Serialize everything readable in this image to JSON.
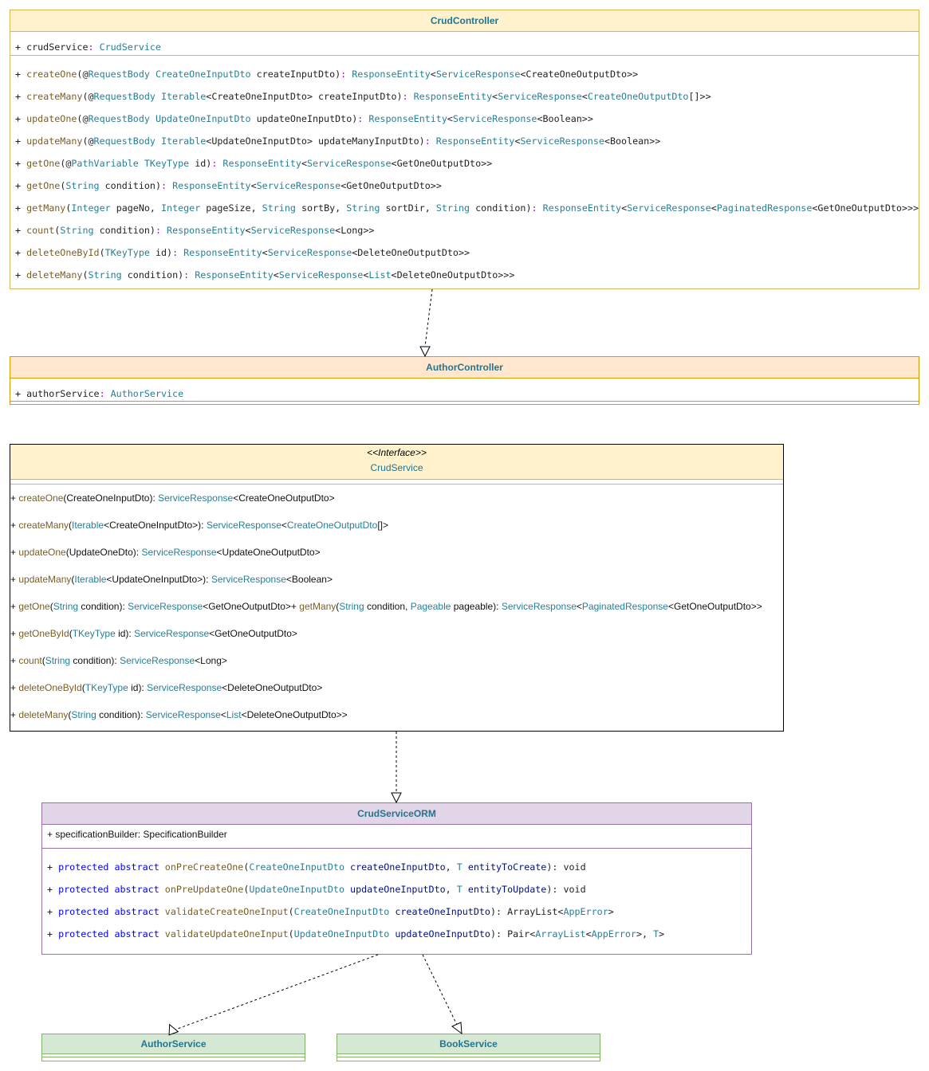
{
  "classes": {
    "crud_controller": {
      "title": "CrudController",
      "attributes": [
        [
          [
            "p",
            "+ crudService"
          ],
          [
            "c",
            ": "
          ],
          [
            "t",
            "CrudService"
          ]
        ]
      ],
      "methods": [
        [
          [
            "p",
            "+ "
          ],
          [
            "m",
            "createOne"
          ],
          [
            "p",
            "(@"
          ],
          [
            "t",
            "RequestBody"
          ],
          [
            "p",
            " "
          ],
          [
            "t",
            "CreateOneInputDto"
          ],
          [
            "p",
            " createInputDto)"
          ],
          [
            "c",
            ": "
          ],
          [
            "t",
            "ResponseEntity"
          ],
          [
            "p",
            "<"
          ],
          [
            "t",
            "ServiceResponse"
          ],
          [
            "p",
            "<CreateOneOutputDto>>"
          ]
        ],
        [
          [
            "p",
            "+ "
          ],
          [
            "m",
            "createMany"
          ],
          [
            "p",
            "(@"
          ],
          [
            "t",
            "RequestBody"
          ],
          [
            "p",
            " "
          ],
          [
            "t",
            "Iterable"
          ],
          [
            "p",
            "<CreateOneInputDto> createInputDto)"
          ],
          [
            "c",
            ": "
          ],
          [
            "t",
            "ResponseEntity"
          ],
          [
            "p",
            "<"
          ],
          [
            "t",
            "ServiceResponse"
          ],
          [
            "p",
            "<"
          ],
          [
            "t",
            "CreateOneOutputDto"
          ],
          [
            "p",
            "[]>>"
          ]
        ],
        [
          [
            "p",
            "+ "
          ],
          [
            "m",
            "updateOne"
          ],
          [
            "p",
            "(@"
          ],
          [
            "t",
            "RequestBody"
          ],
          [
            "p",
            " "
          ],
          [
            "t",
            "UpdateOneInputDto"
          ],
          [
            "p",
            " updateOneInputDto)"
          ],
          [
            "c",
            ": "
          ],
          [
            "t",
            "ResponseEntity"
          ],
          [
            "p",
            "<"
          ],
          [
            "t",
            "ServiceResponse"
          ],
          [
            "p",
            "<Boolean>>"
          ]
        ],
        [
          [
            "p",
            "+ "
          ],
          [
            "m",
            "updateMany"
          ],
          [
            "p",
            "(@"
          ],
          [
            "t",
            "RequestBody"
          ],
          [
            "p",
            " "
          ],
          [
            "t",
            "Iterable"
          ],
          [
            "p",
            "<UpdateOneInputDto> updateManyInputDto)"
          ],
          [
            "c",
            ": "
          ],
          [
            "t",
            "ResponseEntity"
          ],
          [
            "p",
            "<"
          ],
          [
            "t",
            "ServiceResponse"
          ],
          [
            "p",
            "<Boolean>>"
          ]
        ],
        [
          [
            "p",
            "+ "
          ],
          [
            "m",
            "getOne"
          ],
          [
            "p",
            "(@"
          ],
          [
            "t",
            "PathVariable"
          ],
          [
            "p",
            " "
          ],
          [
            "t",
            "TKeyType"
          ],
          [
            "p",
            " id)"
          ],
          [
            "c",
            ": "
          ],
          [
            "t",
            "ResponseEntity"
          ],
          [
            "p",
            "<"
          ],
          [
            "t",
            "ServiceResponse"
          ],
          [
            "p",
            "<GetOneOutputDto>>"
          ]
        ],
        [
          [
            "p",
            "+ "
          ],
          [
            "m",
            "getOne"
          ],
          [
            "p",
            "("
          ],
          [
            "t",
            "String"
          ],
          [
            "p",
            " condition)"
          ],
          [
            "c",
            ": "
          ],
          [
            "t",
            "ResponseEntity"
          ],
          [
            "p",
            "<"
          ],
          [
            "t",
            "ServiceResponse"
          ],
          [
            "p",
            "<GetOneOutputDto>>"
          ]
        ],
        [
          [
            "p",
            "+ "
          ],
          [
            "m",
            "getMany"
          ],
          [
            "p",
            "("
          ],
          [
            "t",
            "Integer"
          ],
          [
            "p",
            " pageNo, "
          ],
          [
            "t",
            "Integer"
          ],
          [
            "p",
            " pageSize, "
          ],
          [
            "t",
            "String"
          ],
          [
            "p",
            " sortBy, "
          ],
          [
            "t",
            "String"
          ],
          [
            "p",
            " sortDir, "
          ],
          [
            "t",
            "String"
          ],
          [
            "p",
            " condition)"
          ],
          [
            "c",
            ": "
          ],
          [
            "t",
            "ResponseEntity"
          ],
          [
            "p",
            "<"
          ],
          [
            "t",
            "ServiceResponse"
          ],
          [
            "p",
            "<"
          ],
          [
            "t",
            "PaginatedResponse"
          ],
          [
            "p",
            "<GetOneOutputDto>>>"
          ]
        ],
        [
          [
            "p",
            "+ "
          ],
          [
            "m",
            "count"
          ],
          [
            "p",
            "("
          ],
          [
            "t",
            "String"
          ],
          [
            "p",
            " condition)"
          ],
          [
            "c",
            ": "
          ],
          [
            "t",
            "ResponseEntity"
          ],
          [
            "p",
            "<"
          ],
          [
            "t",
            "ServiceResponse"
          ],
          [
            "p",
            "<Long>>"
          ]
        ],
        [
          [
            "p",
            "+ "
          ],
          [
            "m",
            "deleteOneById"
          ],
          [
            "p",
            "("
          ],
          [
            "t",
            "TKeyType"
          ],
          [
            "p",
            " id)"
          ],
          [
            "c",
            ": "
          ],
          [
            "t",
            "ResponseEntity"
          ],
          [
            "p",
            "<"
          ],
          [
            "t",
            "ServiceResponse"
          ],
          [
            "p",
            "<DeleteOneOutputDto>>"
          ]
        ],
        [
          [
            "p",
            "+ "
          ],
          [
            "m",
            "deleteMany"
          ],
          [
            "p",
            "("
          ],
          [
            "t",
            "String"
          ],
          [
            "p",
            " condition)"
          ],
          [
            "c",
            ": "
          ],
          [
            "t",
            "ResponseEntity"
          ],
          [
            "p",
            "<"
          ],
          [
            "t",
            "ServiceResponse"
          ],
          [
            "p",
            "<"
          ],
          [
            "t",
            "List"
          ],
          [
            "p",
            "<DeleteOneOutputDto>>>"
          ]
        ]
      ]
    },
    "author_controller": {
      "title": "AuthorController",
      "attributes": [
        [
          [
            "p",
            "+ authorService"
          ],
          [
            "c",
            ": "
          ],
          [
            "t",
            "AuthorService"
          ]
        ]
      ]
    },
    "crud_service": {
      "stereotype": "<<Interface>>",
      "title": "CrudService",
      "methods": [
        [
          [
            "p",
            "+ "
          ],
          [
            "m",
            "createOne"
          ],
          [
            "p",
            "(CreateOneInputDto): "
          ],
          [
            "t",
            "ServiceResponse"
          ],
          [
            "p",
            "<CreateOneOutputDto>"
          ]
        ],
        [
          [
            "p",
            "+ "
          ],
          [
            "m",
            "createMany"
          ],
          [
            "p",
            "("
          ],
          [
            "t",
            "Iterable"
          ],
          [
            "p",
            "<CreateOneInputDto>): "
          ],
          [
            "t",
            "ServiceResponse"
          ],
          [
            "p",
            "<"
          ],
          [
            "t",
            "CreateOneOutputDto"
          ],
          [
            "p",
            "[]>"
          ]
        ],
        [
          [
            "p",
            "+ "
          ],
          [
            "m",
            "updateOne"
          ],
          [
            "p",
            "(UpdateOneDto): "
          ],
          [
            "t",
            "ServiceResponse"
          ],
          [
            "p",
            "<UpdateOneOutputDto>"
          ]
        ],
        [
          [
            "p",
            "+ "
          ],
          [
            "m",
            "updateMany"
          ],
          [
            "p",
            "("
          ],
          [
            "t",
            "Iterable"
          ],
          [
            "p",
            "<UpdateOneInputDto>): "
          ],
          [
            "t",
            "ServiceResponse"
          ],
          [
            "p",
            "<Boolean>"
          ]
        ],
        [
          [
            "p",
            "+ "
          ],
          [
            "m",
            "getOne"
          ],
          [
            "p",
            "("
          ],
          [
            "t",
            "String"
          ],
          [
            "p",
            " condition): "
          ],
          [
            "t",
            "ServiceResponse"
          ],
          [
            "p",
            "<GetOneOutputDto>+ "
          ],
          [
            "m",
            "getMany"
          ],
          [
            "p",
            "("
          ],
          [
            "t",
            "String"
          ],
          [
            "p",
            " condition, "
          ],
          [
            "t",
            "Pageable"
          ],
          [
            "p",
            " pageable): "
          ],
          [
            "t",
            "ServiceResponse"
          ],
          [
            "p",
            "<"
          ],
          [
            "t",
            "PaginatedResponse"
          ],
          [
            "p",
            "<GetOneOutputDto>>"
          ]
        ],
        [
          [
            "p",
            "+ "
          ],
          [
            "m",
            "getOneById"
          ],
          [
            "p",
            "("
          ],
          [
            "t",
            "TKeyType"
          ],
          [
            "p",
            " id): "
          ],
          [
            "t",
            "ServiceResponse"
          ],
          [
            "p",
            "<GetOneOutputDto>"
          ]
        ],
        [
          [
            "p",
            "+ "
          ],
          [
            "m",
            "count"
          ],
          [
            "p",
            "("
          ],
          [
            "t",
            "String"
          ],
          [
            "p",
            " condition): "
          ],
          [
            "t",
            "ServiceResponse"
          ],
          [
            "p",
            "<Long>"
          ]
        ],
        [
          [
            "p",
            "+ "
          ],
          [
            "m",
            "deleteOneById"
          ],
          [
            "p",
            "("
          ],
          [
            "t",
            "TKeyType"
          ],
          [
            "p",
            " id): "
          ],
          [
            "t",
            "ServiceResponse"
          ],
          [
            "p",
            "<DeleteOneOutputDto>"
          ]
        ],
        [
          [
            "p",
            "+ "
          ],
          [
            "m",
            "deleteMany"
          ],
          [
            "p",
            "("
          ],
          [
            "t",
            "String"
          ],
          [
            "p",
            " condition): "
          ],
          [
            "t",
            "ServiceResponse"
          ],
          [
            "p",
            "<"
          ],
          [
            "t",
            "List"
          ],
          [
            "p",
            "<DeleteOneOutputDto>>"
          ]
        ]
      ]
    },
    "crud_service_orm": {
      "title": "CrudServiceORM",
      "attributes": [
        [
          [
            "p",
            "+ specificationBuilder: SpecificationBuilder"
          ]
        ]
      ],
      "methods": [
        [
          [
            "p",
            "+ "
          ],
          [
            "k",
            "protected abstract"
          ],
          [
            "p",
            " "
          ],
          [
            "m",
            "onPreCreateOne"
          ],
          [
            "p",
            "("
          ],
          [
            "t",
            "CreateOneInputDto"
          ],
          [
            "p",
            " "
          ],
          [
            "v",
            "createOneInputDto"
          ],
          [
            "p",
            ", "
          ],
          [
            "t",
            "T"
          ],
          [
            "p",
            " "
          ],
          [
            "v",
            "entityToCreate"
          ],
          [
            "p",
            "): void"
          ]
        ],
        [
          [
            "p",
            "+ "
          ],
          [
            "k",
            "protected abstract"
          ],
          [
            "p",
            " "
          ],
          [
            "m",
            "onPreUpdateOne"
          ],
          [
            "p",
            "("
          ],
          [
            "t",
            "UpdateOneInputDto"
          ],
          [
            "p",
            " "
          ],
          [
            "v",
            "updateOneInputDto"
          ],
          [
            "p",
            ", "
          ],
          [
            "t",
            "T"
          ],
          [
            "p",
            " "
          ],
          [
            "v",
            "entityToUpdate"
          ],
          [
            "p",
            "): void"
          ]
        ],
        [
          [
            "p",
            "+ "
          ],
          [
            "k",
            "protected abstract"
          ],
          [
            "p",
            " "
          ],
          [
            "m",
            "validateCreateOneInput"
          ],
          [
            "p",
            "("
          ],
          [
            "t",
            "CreateOneInputDto"
          ],
          [
            "p",
            " "
          ],
          [
            "v",
            "createOneInputDto"
          ],
          [
            "p",
            "): ArrayList<"
          ],
          [
            "t",
            "AppError"
          ],
          [
            "p",
            ">"
          ]
        ],
        [
          [
            "p",
            "+ "
          ],
          [
            "k",
            "protected abstract"
          ],
          [
            "p",
            " "
          ],
          [
            "m",
            "validateUpdateOneInput"
          ],
          [
            "p",
            "("
          ],
          [
            "t",
            "UpdateOneInputDto"
          ],
          [
            "p",
            " "
          ],
          [
            "v",
            "updateOneInputDto"
          ],
          [
            "p",
            "): Pair<"
          ],
          [
            "t",
            "ArrayList"
          ],
          [
            "p",
            "<"
          ],
          [
            "t",
            "AppError"
          ],
          [
            "p",
            ">, "
          ],
          [
            "t",
            "T"
          ],
          [
            "p",
            ">"
          ]
        ]
      ]
    },
    "author_service": {
      "title": "AuthorService"
    },
    "book_service": {
      "title": "BookService"
    }
  },
  "colors": {
    "method": "#795e26",
    "type": "#267f99",
    "colon": "#af00db",
    "keyword": "#0000ff",
    "variable": "#001080",
    "title": "#23758f"
  }
}
